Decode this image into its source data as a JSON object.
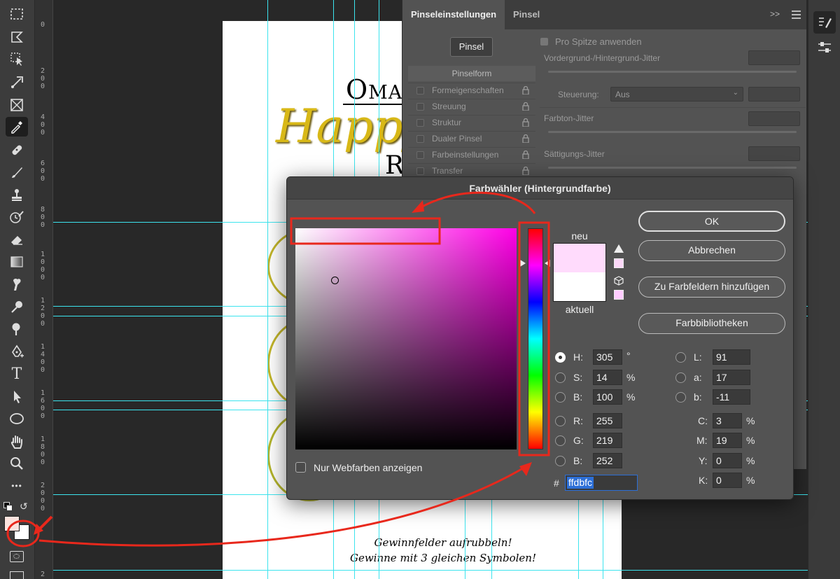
{
  "ruler": {
    "labels": [
      "0",
      "2\n0\n0",
      "4\n0\n0",
      "6\n0\n0",
      "8\n0\n0",
      "1\n0\n0\n0",
      "1\n2\n0\n0",
      "1\n4\n0\n0",
      "1\n6\n0\n0",
      "1\n8\n0\n0",
      "2\n0\n0\n0",
      "2"
    ]
  },
  "colors": {
    "guide": "#3ce4ee",
    "new_color": "#ffdbfc",
    "current_color": "#ffffff",
    "annotation_red": "#e8281c",
    "pure_hue": "#ff00e6"
  },
  "document": {
    "title_text": "Oma",
    "script_text": "Happy",
    "letter_r": "R",
    "footer_line1": "Gewinnfelder aufrubbeln!",
    "footer_line2": "Gewinne mit 3 gleichen Symbolen!"
  },
  "brush_panel": {
    "tab_active": "Pinseleinstellungen",
    "tab_other": "Pinsel",
    "menu_chevrons": ">>",
    "pinsel_button": "Pinsel",
    "list_header": "Pinselform",
    "items": [
      {
        "label": "Formeigenschaften"
      },
      {
        "label": "Streuung"
      },
      {
        "label": "Struktur"
      },
      {
        "label": "Dualer Pinsel"
      },
      {
        "label": "Farbeinstellungen"
      },
      {
        "label": "Transfer"
      }
    ],
    "apply_tip": "Pro Spitze anwenden",
    "fg_bg_jitter": "Vordergrund-/Hintergrund-Jitter",
    "control_label": "Steuerung:",
    "control_value": "Aus",
    "hue_jitter": "Farbton-Jitter",
    "sat_jitter": "Sättigungs-Jitter"
  },
  "dialog": {
    "title": "Farbwähler (Hintergrundfarbe)",
    "ok": "OK",
    "cancel": "Abbrechen",
    "add_swatch": "Zu Farbfeldern hinzufügen",
    "libraries": "Farbbibliotheken",
    "new_label": "neu",
    "current_label": "aktuell",
    "web_only": "Nur Webfarben anzeigen",
    "hsb": [
      {
        "label": "H:",
        "value": "305",
        "unit": "°"
      },
      {
        "label": "S:",
        "value": "14",
        "unit": "%"
      },
      {
        "label": "B:",
        "value": "100",
        "unit": "%"
      }
    ],
    "rgb": [
      {
        "label": "R:",
        "value": "255"
      },
      {
        "label": "G:",
        "value": "219"
      },
      {
        "label": "B:",
        "value": "252"
      }
    ],
    "lab": [
      {
        "label": "L:",
        "value": "91"
      },
      {
        "label": "a:",
        "value": "17"
      },
      {
        "label": "b:",
        "value": "-11"
      }
    ],
    "cmyk": [
      {
        "label": "C:",
        "value": "3",
        "unit": "%"
      },
      {
        "label": "M:",
        "value": "19",
        "unit": "%"
      },
      {
        "label": "Y:",
        "value": "0",
        "unit": "%"
      },
      {
        "label": "K:",
        "value": "0",
        "unit": "%"
      }
    ],
    "hex_label": "#",
    "hex_value": "ffdbfc"
  },
  "toolbar": {
    "tools": [
      "marquee-icon",
      "lasso-icon",
      "object-select-icon",
      "crop-icon",
      "frame-icon",
      "eyedropper-icon",
      "healing-icon",
      "brush-icon",
      "stamp-icon",
      "history-brush-icon",
      "eraser-icon",
      "gradient-icon",
      "smudge-icon",
      "dodge-icon",
      "burn-icon",
      "pen-icon",
      "type-icon",
      "path-select-icon",
      "ellipse-icon",
      "hand-icon",
      "zoom-icon",
      "more-icon"
    ],
    "type_glyph": "T",
    "more_glyph": "•••"
  }
}
